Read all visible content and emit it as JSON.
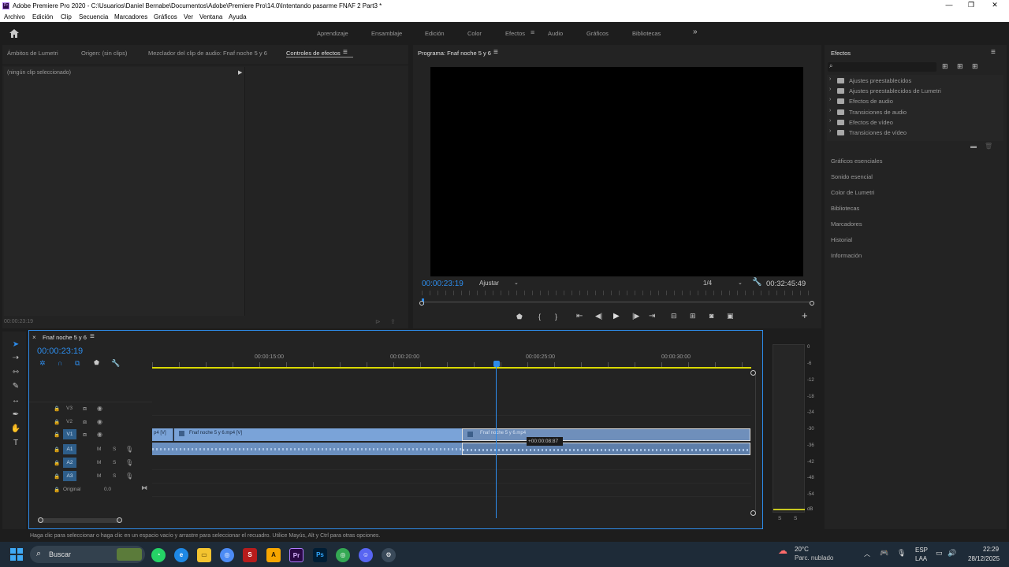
{
  "window": {
    "title": "Adobe Premiere Pro 2020 - C:\\Usuarios\\Daniel Bernabe\\Documentos\\Adobe\\Premiere Pro\\14.0\\Intentando pasarme FNAF 2 Part3 *",
    "icon": "Pr",
    "minimize": "—",
    "maximize": "❐",
    "close": "✕"
  },
  "menu": [
    "Archivo",
    "Edición",
    "Clip",
    "Secuencia",
    "Marcadores",
    "Gráficos",
    "Ver",
    "Ventana",
    "Ayuda"
  ],
  "workspaces": {
    "tabs": [
      "Aprendizaje",
      "Ensamblaje",
      "Edición",
      "Color",
      "Efectos",
      "Audio",
      "Gráficos",
      "Bibliotecas"
    ],
    "active": "Efectos",
    "more": "»",
    "home_icon": "home-icon"
  },
  "source_panel": {
    "tabs": [
      "Ámbitos de Lumetri",
      "Origen: (sin clips)",
      "Mezclador del clip de audio: Fnaf noche 5 y 6",
      "Controles de efectos"
    ],
    "active": "Controles de efectos",
    "no_clip": "(ningún clip seleccionado)",
    "timecode": "00:00:23:19"
  },
  "program": {
    "title": "Programa: Fnaf noche 5 y 6",
    "timecode": "00:00:23:19",
    "fit": "Ajustar",
    "resolution": "1/4",
    "duration": "00:32:45:49",
    "controls": [
      "marker",
      "in",
      "out",
      "go-in",
      "step-back",
      "play",
      "step-fwd",
      "go-out",
      "lift",
      "extract",
      "export-frame",
      "compare"
    ],
    "add": "+"
  },
  "effects": {
    "title": "Efectos",
    "search_placeholder": "",
    "folders": [
      "Ajustes preestablecidos",
      "Ajustes preestablecidos de Lumetri",
      "Efectos de audio",
      "Transiciones de audio",
      "Efectos de vídeo",
      "Transiciones de vídeo"
    ],
    "panels": [
      "Gráficos esenciales",
      "Sonido esencial",
      "Color de Lumetri",
      "Bibliotecas",
      "Marcadores",
      "Historial",
      "Información"
    ]
  },
  "timeline": {
    "title": "Fnaf noche 5 y 6",
    "timecode": "00:00:23:19",
    "ruler": [
      "00:00:15:00",
      "00:00:20:00",
      "00:00:25:00",
      "00:00:30:00"
    ],
    "tracks": {
      "video": [
        "V3",
        "V2",
        "V1"
      ],
      "audio": [
        "A1",
        "A2",
        "A3"
      ],
      "master": "Original",
      "master_value": "0.0",
      "mute": "M",
      "solo": "S"
    },
    "clips": {
      "v1_a": "p4 [V]",
      "v1_b": "Fnaf noche 5 y 6.mp4 [V]",
      "v1_c": "Fnaf noche 5 y 6.mp4",
      "tooltip": "+00:00:08:87"
    }
  },
  "meter": {
    "scale": [
      "0",
      "-6",
      "-12",
      "-18",
      "-24",
      "-30",
      "-36",
      "-42",
      "-48",
      "-54",
      "dB"
    ],
    "solo": [
      "S",
      "S"
    ]
  },
  "status": "Haga clic para seleccionar o haga clic en un espacio vacío y arrastre para seleccionar el recuadro. Utilice Mayús, Alt y Ctrl para otras opciones.",
  "taskbar": {
    "search": "Buscar",
    "weather_temp": "20°C",
    "weather_desc": "Parc. nublado",
    "lang": "ESP",
    "lang2": "LAA",
    "time": "22:29",
    "date": "28/12/2025"
  }
}
